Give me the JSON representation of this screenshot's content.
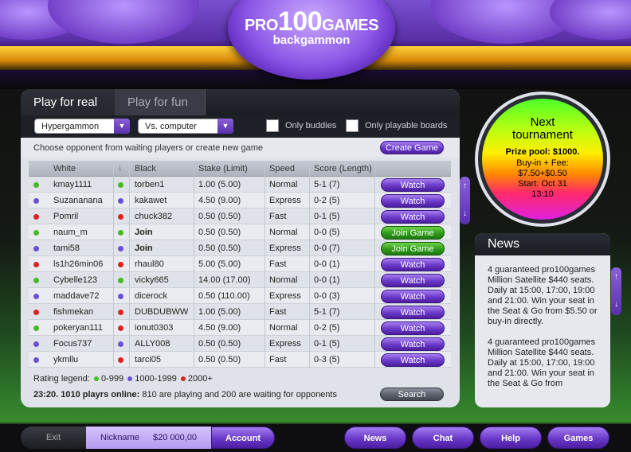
{
  "brand": {
    "pro": "PRO",
    "num": "100",
    "games": "GAMES",
    "sub": "backgammon"
  },
  "tabs": [
    {
      "label": "Play for real",
      "active": true
    },
    {
      "label": "Play for fun",
      "active": false
    }
  ],
  "filters": {
    "variant": "Hypergammon",
    "opponent": "Vs. computer",
    "only_buddies": "Only buddies",
    "only_playable": "Only playable boards"
  },
  "toolbar": {
    "instruction": "Choose opponent from waiting players or create new game",
    "create_label": "Create Game"
  },
  "table": {
    "columns": [
      "White",
      "Black",
      "Stake (Limit)",
      "Speed",
      "Score (Length)"
    ],
    "rows": [
      {
        "white": "kmay1111",
        "wdot": "#44bb22",
        "black": "torben1",
        "bdot": "#44bb22",
        "stake": "1.00 (5.00)",
        "speed": "Normal",
        "score": "5-1 (7)",
        "action": "Watch"
      },
      {
        "white": "Suzananana",
        "wdot": "#6a4fd8",
        "black": "kakawet",
        "bdot": "#6a4fd8",
        "stake": "4.50 (9.00)",
        "speed": "Express",
        "score": "0-2 (5)",
        "action": "Watch"
      },
      {
        "white": "Pomril",
        "wdot": "#dd2222",
        "black": "chuck382",
        "bdot": "#dd2222",
        "stake": "0.50 (0.50)",
        "speed": "Fast",
        "score": "0-1 (5)",
        "action": "Watch"
      },
      {
        "white": "naum_m",
        "wdot": "#44bb22",
        "black": "Join",
        "bdot": "#44bb22",
        "stake": "0.50 (0.50)",
        "speed": "Normal",
        "score": "0-0 (5)",
        "action": "Join Game",
        "join": true
      },
      {
        "white": "tami58",
        "wdot": "#6a4fd8",
        "black": "Join",
        "bdot": "#6a4fd8",
        "stake": "0.50 (0.50)",
        "speed": "Express",
        "score": "0-0 (7)",
        "action": "Join Game",
        "join": true
      },
      {
        "white": "ls1h26min06",
        "wdot": "#dd2222",
        "black": "rhaul80",
        "bdot": "#dd2222",
        "stake": "5.00 (5.00)",
        "speed": "Fast",
        "score": "0-0 (1)",
        "action": "Watch"
      },
      {
        "white": "Cybelle123",
        "wdot": "#44bb22",
        "black": "vicky665",
        "bdot": "#44bb22",
        "stake": "14.00 (17.00)",
        "speed": "Normal",
        "score": "0-0 (1)",
        "action": "Watch"
      },
      {
        "white": "maddave72",
        "wdot": "#6a4fd8",
        "black": "dicerock",
        "bdot": "#6a4fd8",
        "stake": "0.50 (110.00)",
        "speed": "Express",
        "score": "0-0 (3)",
        "action": "Watch"
      },
      {
        "white": "fishmekan",
        "wdot": "#dd2222",
        "black": "DUBDUBWW",
        "bdot": "#dd2222",
        "stake": "1.00 (5.00)",
        "speed": "Fast",
        "score": "5-1 (7)",
        "action": "Watch"
      },
      {
        "white": "pokeryan111",
        "wdot": "#44bb22",
        "black": "ionut0303",
        "bdot": "#dd2222",
        "stake": "4.50 (9.00)",
        "speed": "Normal",
        "score": "0-2 (5)",
        "action": "Watch"
      },
      {
        "white": "Focus737",
        "wdot": "#6a4fd8",
        "black": "ALLY008",
        "bdot": "#6a4fd8",
        "stake": "0.50 (0.50)",
        "speed": "Express",
        "score": "0-1 (5)",
        "action": "Watch"
      },
      {
        "white": "ykmllu",
        "wdot": "#6a4fd8",
        "black": "tarci05",
        "bdot": "#dd2222",
        "stake": "0.50 (0.50)",
        "speed": "Fast",
        "score": "0-3 (5)",
        "action": "Watch"
      }
    ]
  },
  "legend": {
    "label": "Rating legend:",
    "r1": "0-999",
    "r2": "1000-1999",
    "r3": "2000+",
    "c1": "#44bb22",
    "c2": "#6a4fd8",
    "c3": "#dd2222"
  },
  "status": {
    "time_players": "23:20. 1010 playrs online:",
    "detail": " 810 are playing and 200 are waiting for opponents",
    "search": "Search"
  },
  "tournament": {
    "title1": "Next",
    "title2": "tournament",
    "prize": "Prize pool: $1000.",
    "buyin": "Buy-in + Fee:",
    "fee": "$7.50+$0.50",
    "start": "Start: Oct 31",
    "time": "13:10"
  },
  "news": {
    "title": "News",
    "items": [
      "4 guaranteed pro100games Million Satellite $440 seats. Daily at 15:00, 17:00, 19:00 and 21:00. Win your seat in the Seat & Go from $5.50 or buy-in directly.",
      "4 guaranteed pro100games Million Satellite $440 seats. Daily at 15:00, 17:00, 19:00 and 21:00. Win your seat in the Seat & Go from"
    ]
  },
  "footer": {
    "exit": "Exit",
    "nickname": "Nickname",
    "balance": "$20 000,00",
    "account": "Account",
    "news": "News",
    "chat": "Chat",
    "help": "Help",
    "games": "Games"
  }
}
